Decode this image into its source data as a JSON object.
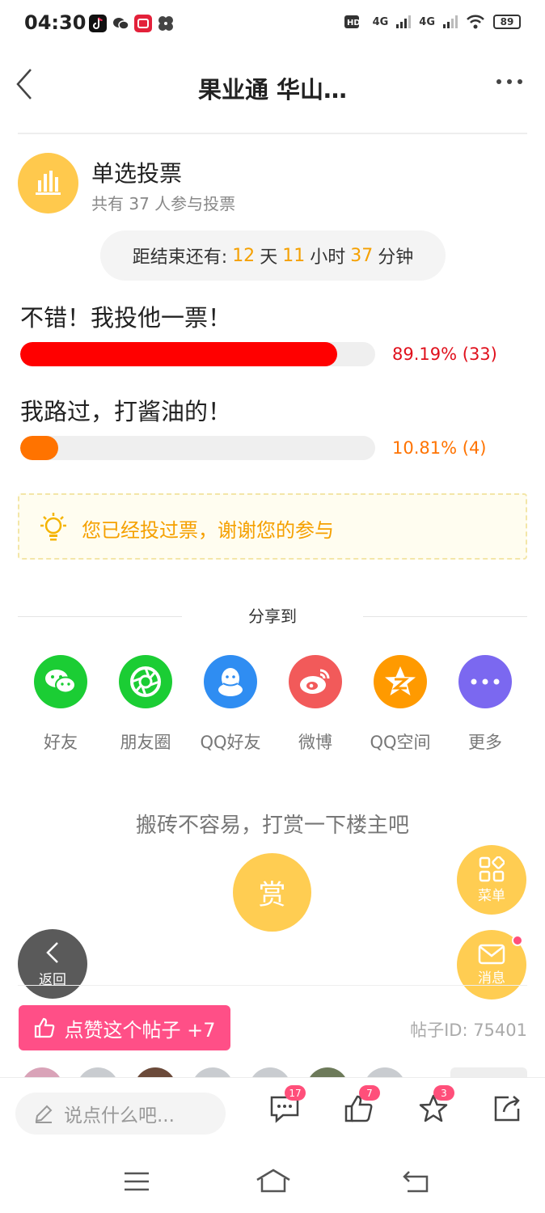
{
  "status_bar": {
    "time": "04:30",
    "battery": "89",
    "network_1": "4G",
    "network_2": "4G"
  },
  "header": {
    "title": "果业通 华山…"
  },
  "vote": {
    "title": "单选投票",
    "participants": "共有 37 人参与投票",
    "countdown": {
      "prefix": "距结束还有:",
      "days": "12",
      "days_unit": "天",
      "hours": "11",
      "hours_unit": "小时",
      "minutes": "37",
      "minutes_unit": "分钟"
    },
    "options": [
      {
        "label": "不错！我投他一票！",
        "percent_text": "89.19% (33)",
        "fraction": 0.8919,
        "color": "#ff0000"
      },
      {
        "label": "我路过，打酱油的！",
        "percent_text": "10.81% (4)",
        "fraction": 0.1081,
        "color": "#ff7300"
      }
    ],
    "voted_notice": "您已经投过票，谢谢您的参与"
  },
  "share": {
    "label": "分享到",
    "items": [
      {
        "label": "好友",
        "icon": "wechat-icon",
        "color": "#1bcd34"
      },
      {
        "label": "朋友圈",
        "icon": "moments-icon",
        "color": "#1bcd34"
      },
      {
        "label": "QQ好友",
        "icon": "qq-icon",
        "color": "#2f8df2"
      },
      {
        "label": "微博",
        "icon": "weibo-icon",
        "color": "#f25a5a"
      },
      {
        "label": "QQ空间",
        "icon": "qzone-icon",
        "color": "#ff9a00"
      },
      {
        "label": "更多",
        "icon": "more-icon",
        "color": "#7b68f0"
      }
    ]
  },
  "reward": {
    "tip": "搬砖不容易，打赏一下楼主吧",
    "button": "赏"
  },
  "fabs": {
    "menu": "菜单",
    "message": "消息",
    "back": "返回"
  },
  "post": {
    "like_button": "点赞这个帖子 +7",
    "post_id": "帖子ID: 75401"
  },
  "bottom_bar": {
    "comment_placeholder": "说点什么吧...",
    "comment_count": "17",
    "like_count": "7",
    "favorite_count": "3"
  }
}
